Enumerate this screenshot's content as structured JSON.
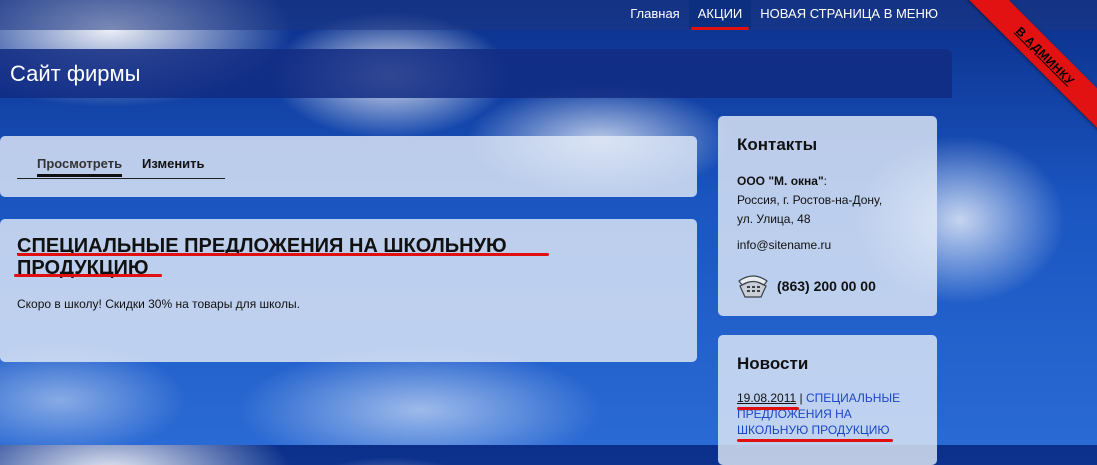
{
  "top_menu": {
    "items": [
      {
        "label": "Главная"
      },
      {
        "label": "АКЦИИ"
      },
      {
        "label": "НОВАЯ СТРАНИЦА В МЕНЮ"
      }
    ]
  },
  "admin_ribbon": {
    "label": "В АДМИНКУ",
    "color": "#e21212"
  },
  "header": {
    "site_title": "Сайт фирмы"
  },
  "tabs": {
    "view": "Просмотреть",
    "edit": "Изменить"
  },
  "post": {
    "title": "СПЕЦИАЛЬНЫЕ ПРЕДЛОЖЕНИЯ НА ШКОЛЬНУЮ ПРОДУКЦИЮ",
    "body": "Скоро в школу! Скидки 30% на товары для школы."
  },
  "contacts": {
    "title": "Контакты",
    "company": "ООО \"М. окна\"",
    "company_suffix": ":",
    "address_line1": "Россия, г. Ростов-на-Дону,",
    "address_line2": "ул. Улица, 48",
    "email": "info@sitename.ru",
    "phone": "(863) 200 00 00",
    "phone_icon": "telephone-icon"
  },
  "news": {
    "title": "Новости",
    "items": [
      {
        "date": "19.08.2011",
        "separator": "|",
        "link": "СПЕЦИАЛЬНЫЕ ПРЕДЛОЖЕНИЯ НА ШКОЛЬНУЮ ПРОДУКЦИЮ"
      }
    ]
  },
  "colors": {
    "accent_red": "#e01010",
    "header_blue": "#122c82",
    "link_blue": "#1a46c8"
  }
}
